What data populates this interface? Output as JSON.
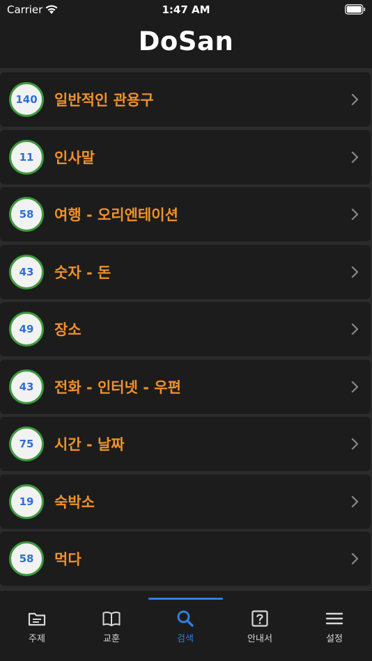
{
  "status_bar": {
    "carrier": "Carrier",
    "time": "1:47 AM"
  },
  "header": {
    "title": "DoSan"
  },
  "topics": [
    {
      "count": "140",
      "label": "일반적인 관용구"
    },
    {
      "count": "11",
      "label": "인사말"
    },
    {
      "count": "58",
      "label": "여행 - 오리엔테이션"
    },
    {
      "count": "43",
      "label": "숫자 - 돈"
    },
    {
      "count": "49",
      "label": "장소"
    },
    {
      "count": "43",
      "label": "전화 - 인터넷 - 우편"
    },
    {
      "count": "75",
      "label": "시간 - 날짜"
    },
    {
      "count": "19",
      "label": "숙박소"
    },
    {
      "count": "58",
      "label": "먹다"
    }
  ],
  "tabs": [
    {
      "label": "주제",
      "icon": "folder-icon"
    },
    {
      "label": "교훈",
      "icon": "book-icon"
    },
    {
      "label": "검색",
      "icon": "search-icon",
      "active": true
    },
    {
      "label": "안내서",
      "icon": "help-icon"
    },
    {
      "label": "설정",
      "icon": "menu-icon"
    }
  ],
  "colors": {
    "accent": "#2f7fe0",
    "label_orange": "#f0922a",
    "badge_ring": "#3d9a3d",
    "badge_text": "#2d6fd6"
  }
}
